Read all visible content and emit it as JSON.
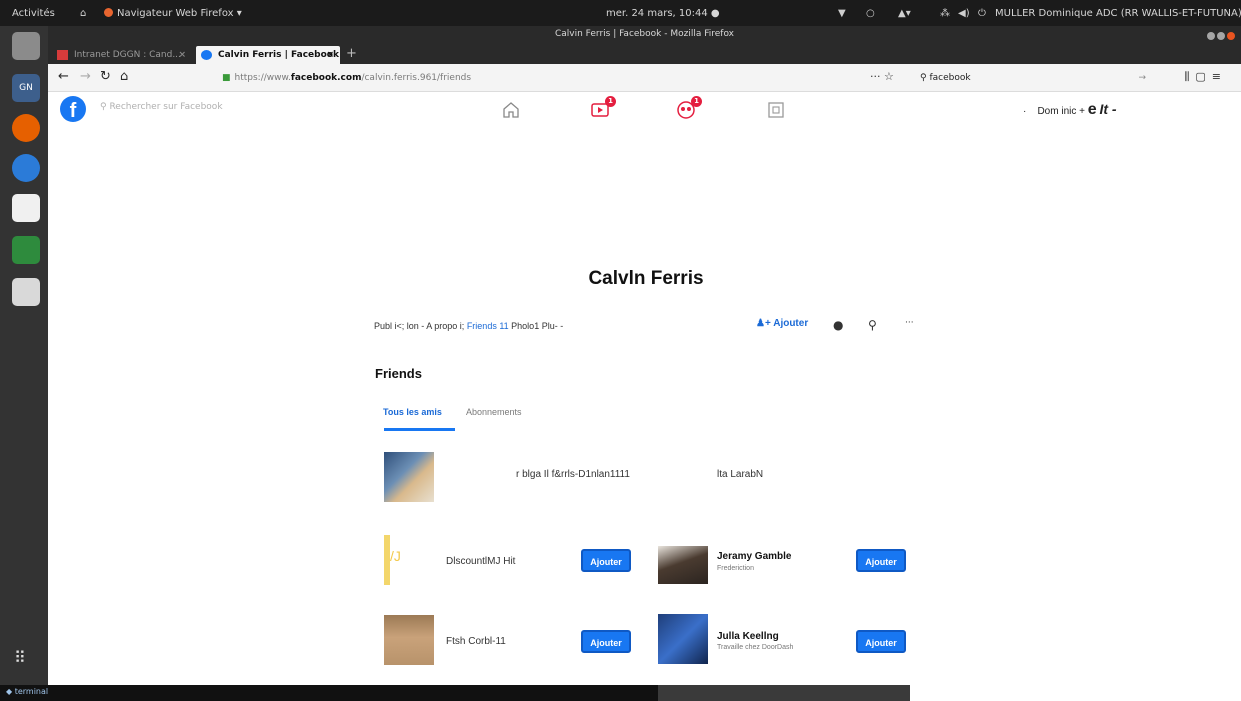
{
  "gnome": {
    "activities": "Activités",
    "app_menu": "Navigateur Web Firefox ▾",
    "clock": "mer. 24 mars, 10:44 ●",
    "user": "MULLER Dominique ADC (RR WALLIS-ET-FUTUNA) ▾"
  },
  "window": {
    "title": "Calvin Ferris | Facebook - Mozilla Firefox"
  },
  "tabs": [
    {
      "label": "Intranet DGGN : Cand..."
    },
    {
      "label": "Calvin Ferris | Facebook"
    }
  ],
  "url": {
    "prefix": "https://www.",
    "host": "facebook.com",
    "path": "/calvin.ferris.961/friends"
  },
  "search_engine_text": "facebook",
  "facebook": {
    "search_placeholder": "Rechercher sur Facebook",
    "badges": [
      "1",
      "1"
    ],
    "user_left": "Dom inic +",
    "user_big1": "e",
    "user_big2": "It -"
  },
  "profile": {
    "name": "Calvln Ferris",
    "tabs_pre": "Publ i<; lon -  A propo i; ",
    "tabs_friends": "Friends 11",
    "tabs_post": " Pholo1 Plu- -",
    "add_button": "Ajouter",
    "more_label": "···"
  },
  "friends_section": {
    "title": "Friends",
    "tab_all": "Tous les amis",
    "tab_following": "Abonnements",
    "row1_text_a": "r blga Il f&rrls-D1nlan1111",
    "row1_text_b": "lta LarabN",
    "items": [
      {
        "name": "DlscountlMJ Hit",
        "subtitle": "",
        "button": "Ajouter"
      },
      {
        "name": "Jeramy Gamble",
        "subtitle": "Frederiction",
        "button": "Ajouter"
      },
      {
        "name": "Ftsh Corbl-11",
        "subtitle": "",
        "button": "Ajouter"
      },
      {
        "name": "Julla Keellng",
        "subtitle": "Travaille chez DoorDash",
        "button": "Ajouter"
      }
    ]
  },
  "dock": {
    "gn_label": "GN"
  },
  "taskbar": {
    "label": "terminal"
  },
  "colors": {
    "facebook_blue": "#1877f2",
    "notif_red": "#e41e3f",
    "ubuntu_orange": "#e95420"
  },
  "icons": [
    "home-icon",
    "video-icon",
    "groups-icon",
    "gaming-icon",
    "search-icon",
    "messenger-icon",
    "lock-icon",
    "star-icon"
  ]
}
